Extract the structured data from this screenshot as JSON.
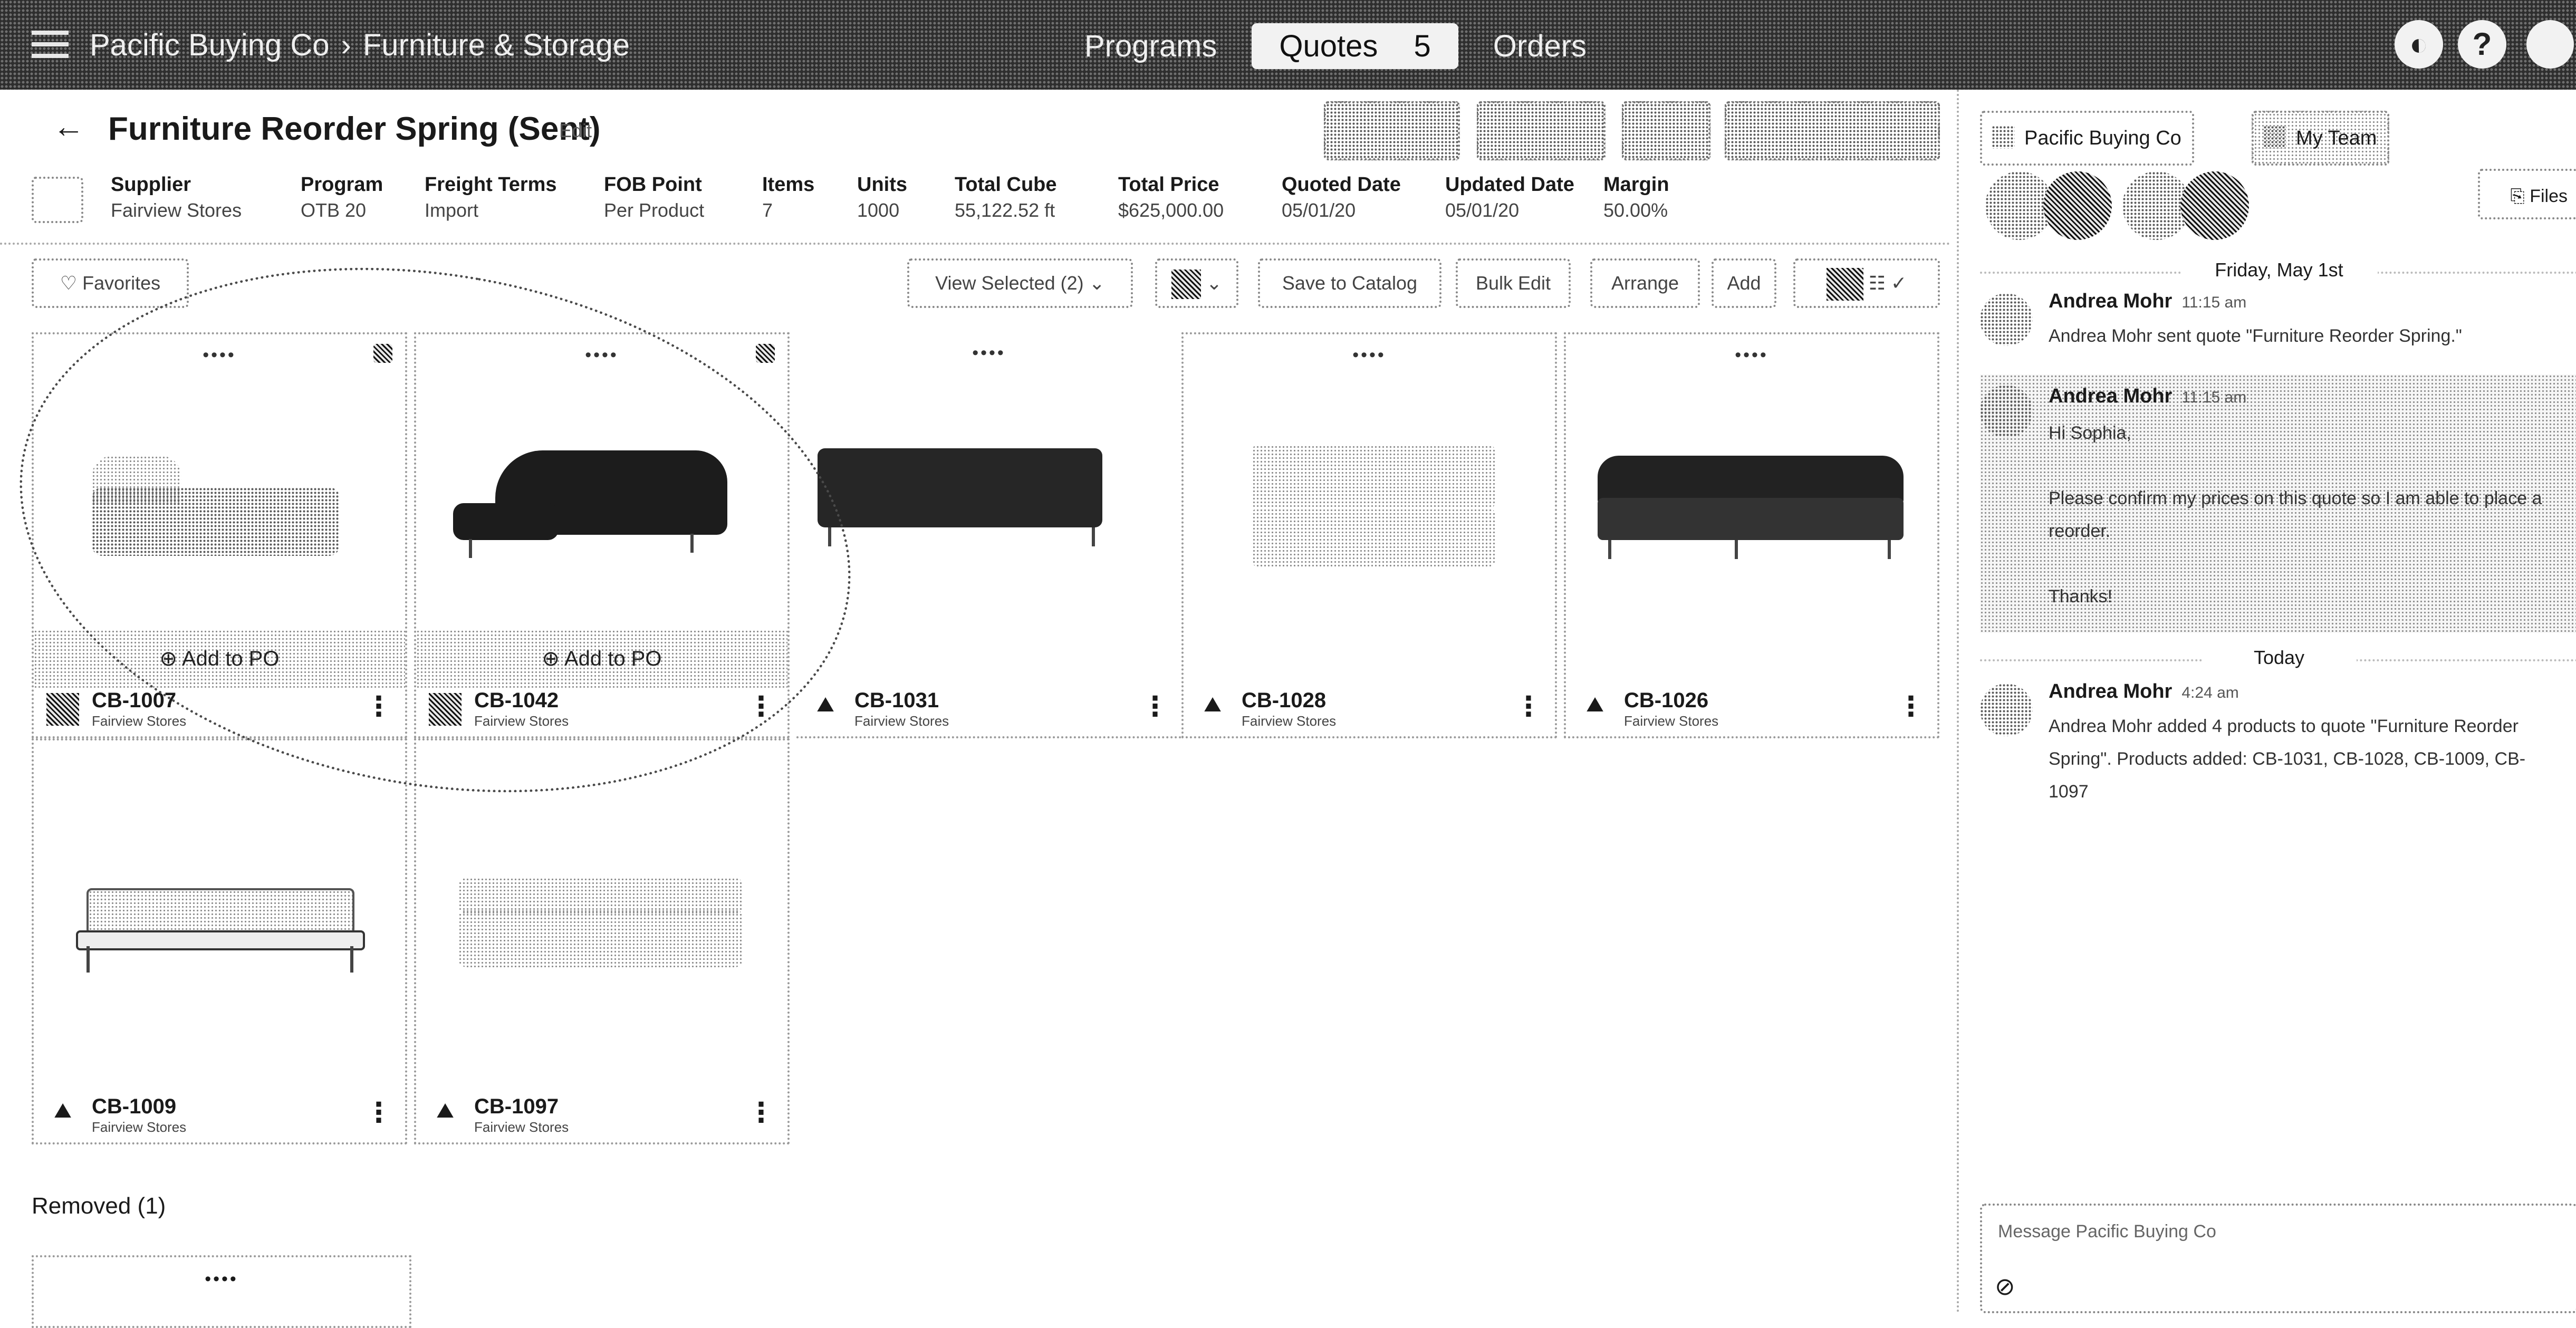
{
  "header": {
    "org": "Pacific Buying Co",
    "section": "Furniture & Storage",
    "nav": [
      "Programs",
      "Quotes",
      "Orders"
    ],
    "active_nav": "Quotes",
    "active_nav_badge": "5",
    "help_glyph": "?"
  },
  "page": {
    "title": "Furniture Reorder Spring (Sent)",
    "edit_label": "Edit"
  },
  "summary": {
    "fields": [
      {
        "label": "Supplier",
        "value": "Fairview Stores"
      },
      {
        "label": "Program",
        "value": "OTB 20"
      },
      {
        "label": "Freight Terms",
        "value": "Import"
      },
      {
        "label": "FOB Point",
        "value": "Per Product"
      },
      {
        "label": "Items",
        "value": "7"
      },
      {
        "label": "Units",
        "value": "1000"
      },
      {
        "label": "Total Cube",
        "value": "55,122.52 ft"
      },
      {
        "label": "Total Price",
        "value": "$625,000.00"
      },
      {
        "label": "Quoted Date",
        "value": "05/01/20"
      },
      {
        "label": "Updated Date",
        "value": "05/01/20"
      },
      {
        "label": "Margin",
        "value": "50.00%"
      }
    ]
  },
  "toolbar": {
    "favorites": "Favorites",
    "view_selected": "View Selected (2)",
    "save_to_catalog": "Save to Catalog",
    "bulk_edit": "Bulk Edit",
    "arrange": "Arrange",
    "add": "Add"
  },
  "products": [
    {
      "sku": "CB-1007",
      "supplier": "Fairview Stores",
      "status": "••••",
      "selected": true,
      "add_label": "Add to PO"
    },
    {
      "sku": "CB-1042",
      "supplier": "Fairview Stores",
      "status": "••••",
      "selected": true,
      "add_label": "Add to PO"
    },
    {
      "sku": "CB-1031",
      "supplier": "Fairview Stores",
      "status": "••••",
      "selected": false
    },
    {
      "sku": "CB-1028",
      "supplier": "Fairview Stores",
      "status": "••••",
      "selected": false
    },
    {
      "sku": "CB-1026",
      "supplier": "Fairview Stores",
      "status": "••••",
      "selected": false
    },
    {
      "sku": "CB-1009",
      "supplier": "Fairview Stores",
      "status": "••••",
      "selected": false
    },
    {
      "sku": "CB-1097",
      "supplier": "Fairview Stores",
      "status": "••••",
      "selected": false
    }
  ],
  "removed": {
    "label": "Removed (1)",
    "card_status": "••••"
  },
  "panel": {
    "tabs": [
      "Pacific Buying Co",
      "My Team"
    ],
    "files_label": "Files",
    "days": [
      {
        "label": "Friday, May 1st",
        "messages": [
          {
            "author": "Andrea Mohr",
            "time": "11:15 am",
            "body": "Andrea Mohr sent quote \"Furniture Reorder Spring.\""
          },
          {
            "author": "Andrea Mohr",
            "time": "11:15 am",
            "body": "Hi Sophia,\n\nPlease confirm my prices on this quote so I am able to place a reorder.\n\nThanks!"
          }
        ]
      },
      {
        "label": "Today",
        "messages": [
          {
            "author": "Andrea Mohr",
            "time": "4:24 am",
            "body": "Andrea Mohr added 4 products to quote \"Furniture Reorder Spring\". Products added: CB-1031, CB-1028, CB-1009, CB-1097"
          }
        ]
      }
    ],
    "compose_placeholder": "Message Pacific Buying Co"
  }
}
